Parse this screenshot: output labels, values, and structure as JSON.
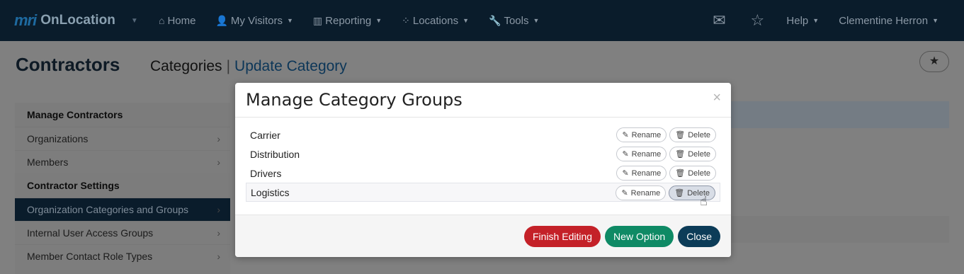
{
  "nav": {
    "brand_logo": "mri",
    "brand_name": "OnLocation",
    "items": [
      {
        "icon": "home-icon",
        "glyph": "⌂",
        "label": "Home"
      },
      {
        "icon": "user-icon",
        "glyph": "👤",
        "label": "My Visitors"
      },
      {
        "icon": "chart-icon",
        "glyph": "▥",
        "label": "Reporting"
      },
      {
        "icon": "network-icon",
        "glyph": "⁘",
        "label": "Locations"
      },
      {
        "icon": "wrench-icon",
        "glyph": "🔧",
        "label": "Tools"
      }
    ],
    "help_label": "Help",
    "user_name": "Clementine Herron"
  },
  "page": {
    "title": "Contractors",
    "breadcrumb_current": "Categories",
    "breadcrumb_link": "Update Category"
  },
  "sidebar": {
    "section1": "Manage Contractors",
    "items1": [
      "Organizations",
      "Members"
    ],
    "section2": "Contractor Settings",
    "items2": [
      "Organization Categories and Groups",
      "Internal User Access Groups",
      "Member Contact Role Types"
    ]
  },
  "modal": {
    "title": "Manage Category Groups",
    "close_glyph": "×",
    "rename_label": "Rename",
    "delete_label": "Delete",
    "groups": [
      "Carrier",
      "Distribution",
      "Drivers",
      "Logistics"
    ],
    "finish_label": "Finish Editing",
    "new_option_label": "New Option",
    "close_label": "Close"
  }
}
